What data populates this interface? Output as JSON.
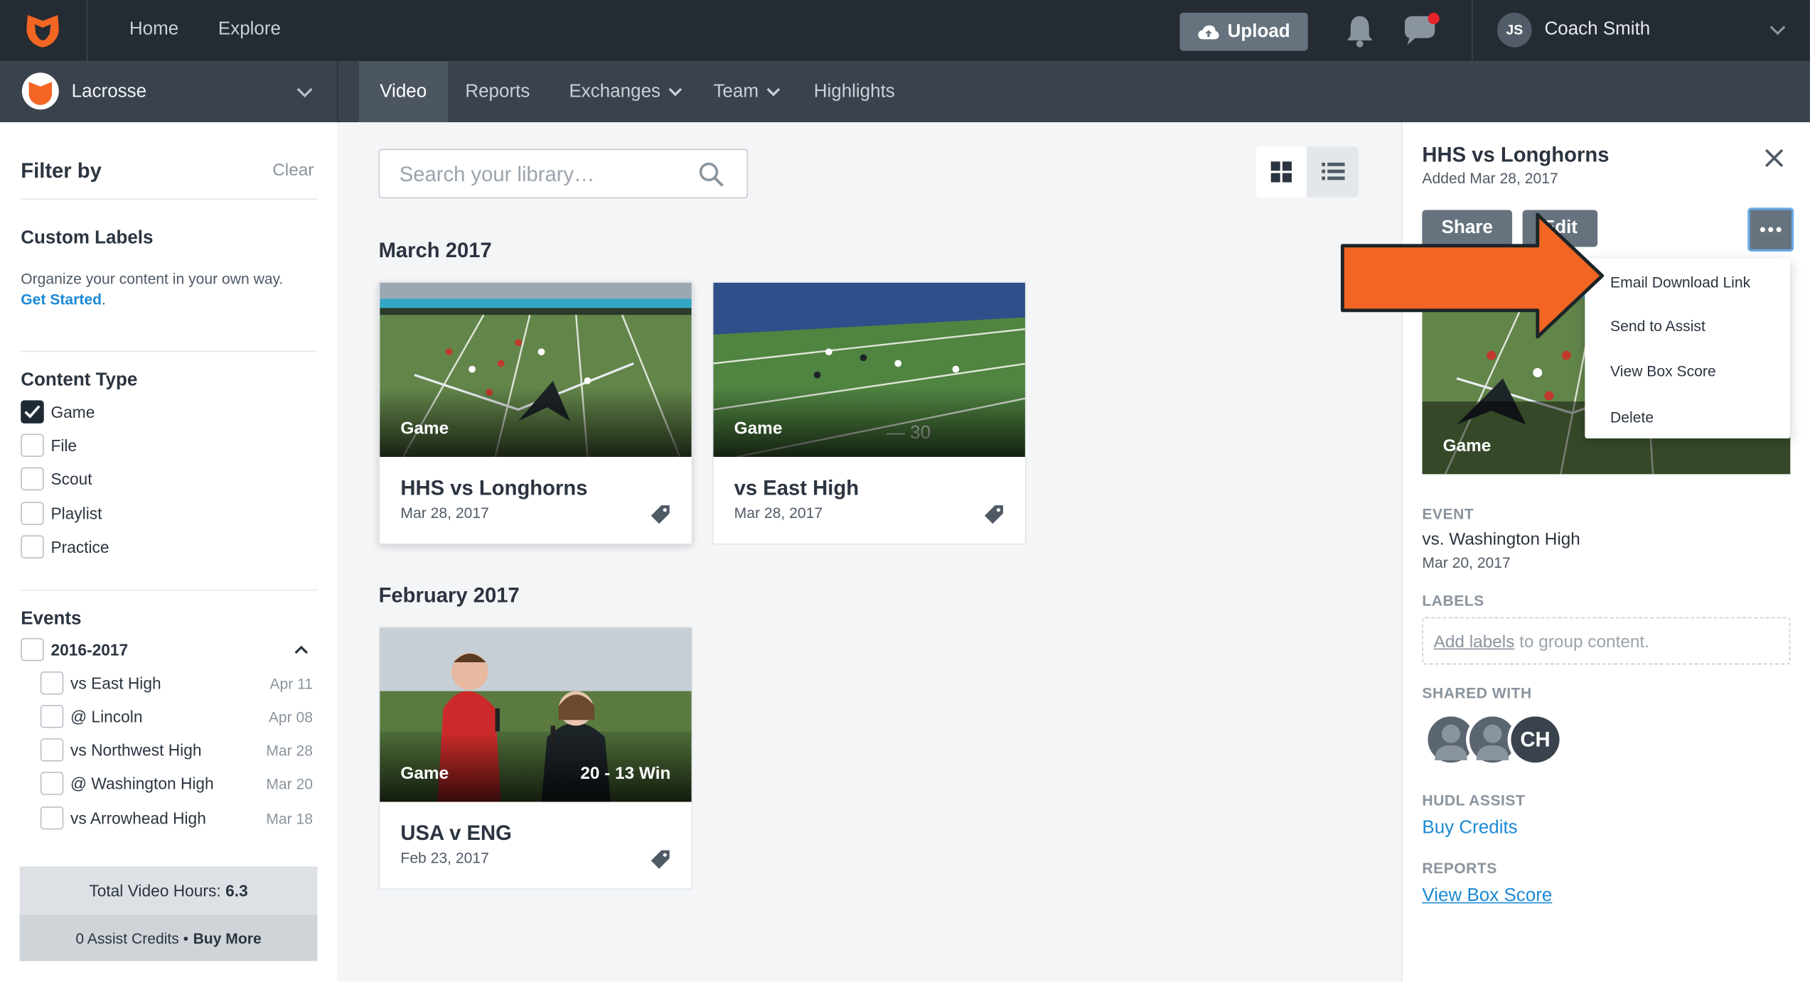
{
  "topbar": {
    "nav": [
      "Home",
      "Explore"
    ],
    "upload_label": "Upload",
    "user_initials": "JS",
    "user_name": "Coach Smith"
  },
  "subbar": {
    "team_name": "Lacrosse",
    "tabs": [
      "Video",
      "Reports",
      "Exchanges",
      "Team",
      "Highlights"
    ],
    "active_tab": "Video"
  },
  "sidebar": {
    "filter_title": "Filter by",
    "clear_label": "Clear",
    "custom_labels_title": "Custom Labels",
    "custom_labels_text": "Organize your content in your own way.",
    "get_started": "Get Started",
    "content_type_title": "Content Type",
    "content_types": [
      {
        "label": "Game",
        "checked": true
      },
      {
        "label": "File",
        "checked": false
      },
      {
        "label": "Scout",
        "checked": false
      },
      {
        "label": "Playlist",
        "checked": false
      },
      {
        "label": "Practice",
        "checked": false
      }
    ],
    "events_title": "Events",
    "season": "2016-2017",
    "events": [
      {
        "label": "vs East High",
        "date": "Apr 11"
      },
      {
        "label": "@ Lincoln",
        "date": "Apr 08"
      },
      {
        "label": "vs Northwest High",
        "date": "Mar 28"
      },
      {
        "label": "@ Washington High",
        "date": "Mar 20"
      },
      {
        "label": "vs Arrowhead High",
        "date": "Mar 18"
      }
    ],
    "total_hours_label": "Total Video Hours:",
    "total_hours_value": "6.3",
    "credits_label": "0 Assist Credits •",
    "buy_more": "Buy More"
  },
  "main": {
    "search_placeholder": "Search your library…",
    "months": [
      "March 2017",
      "February 2017"
    ],
    "cards": [
      {
        "type": "Game",
        "title": "HHS vs Longhorns",
        "date": "Mar 28, 2017",
        "score": ""
      },
      {
        "type": "Game",
        "title": "vs East High",
        "date": "Mar 28, 2017",
        "score": ""
      },
      {
        "type": "Game",
        "title": "USA v ENG",
        "date": "Feb 23, 2017",
        "score": "20 - 13 Win"
      }
    ]
  },
  "panel": {
    "title": "HHS vs Longhorns",
    "added": "Added Mar 28, 2017",
    "share_label": "Share",
    "edit_label": "Edit",
    "thumb_label": "Game",
    "event_heading": "EVENT",
    "event_name": "vs. Washington High",
    "event_date": "Mar 20, 2017",
    "labels_heading": "LABELS",
    "add_labels_link": "Add labels",
    "add_labels_rest": " to group content.",
    "shared_heading": "SHARED WITH",
    "shared_initials": "CH",
    "assist_heading": "HUDL ASSIST",
    "buy_credits": "Buy Credits",
    "reports_heading": "REPORTS",
    "view_box_score": "View Box Score"
  },
  "dropdown": {
    "items": [
      "Email Download Link",
      "Send to Assist",
      "View Box Score",
      "Delete"
    ]
  },
  "colors": {
    "topbar": "#242b33",
    "subbar": "#3a434d",
    "accent_orange": "#f26522",
    "link_blue": "#1b8ad6",
    "button_gray": "#66737f"
  }
}
